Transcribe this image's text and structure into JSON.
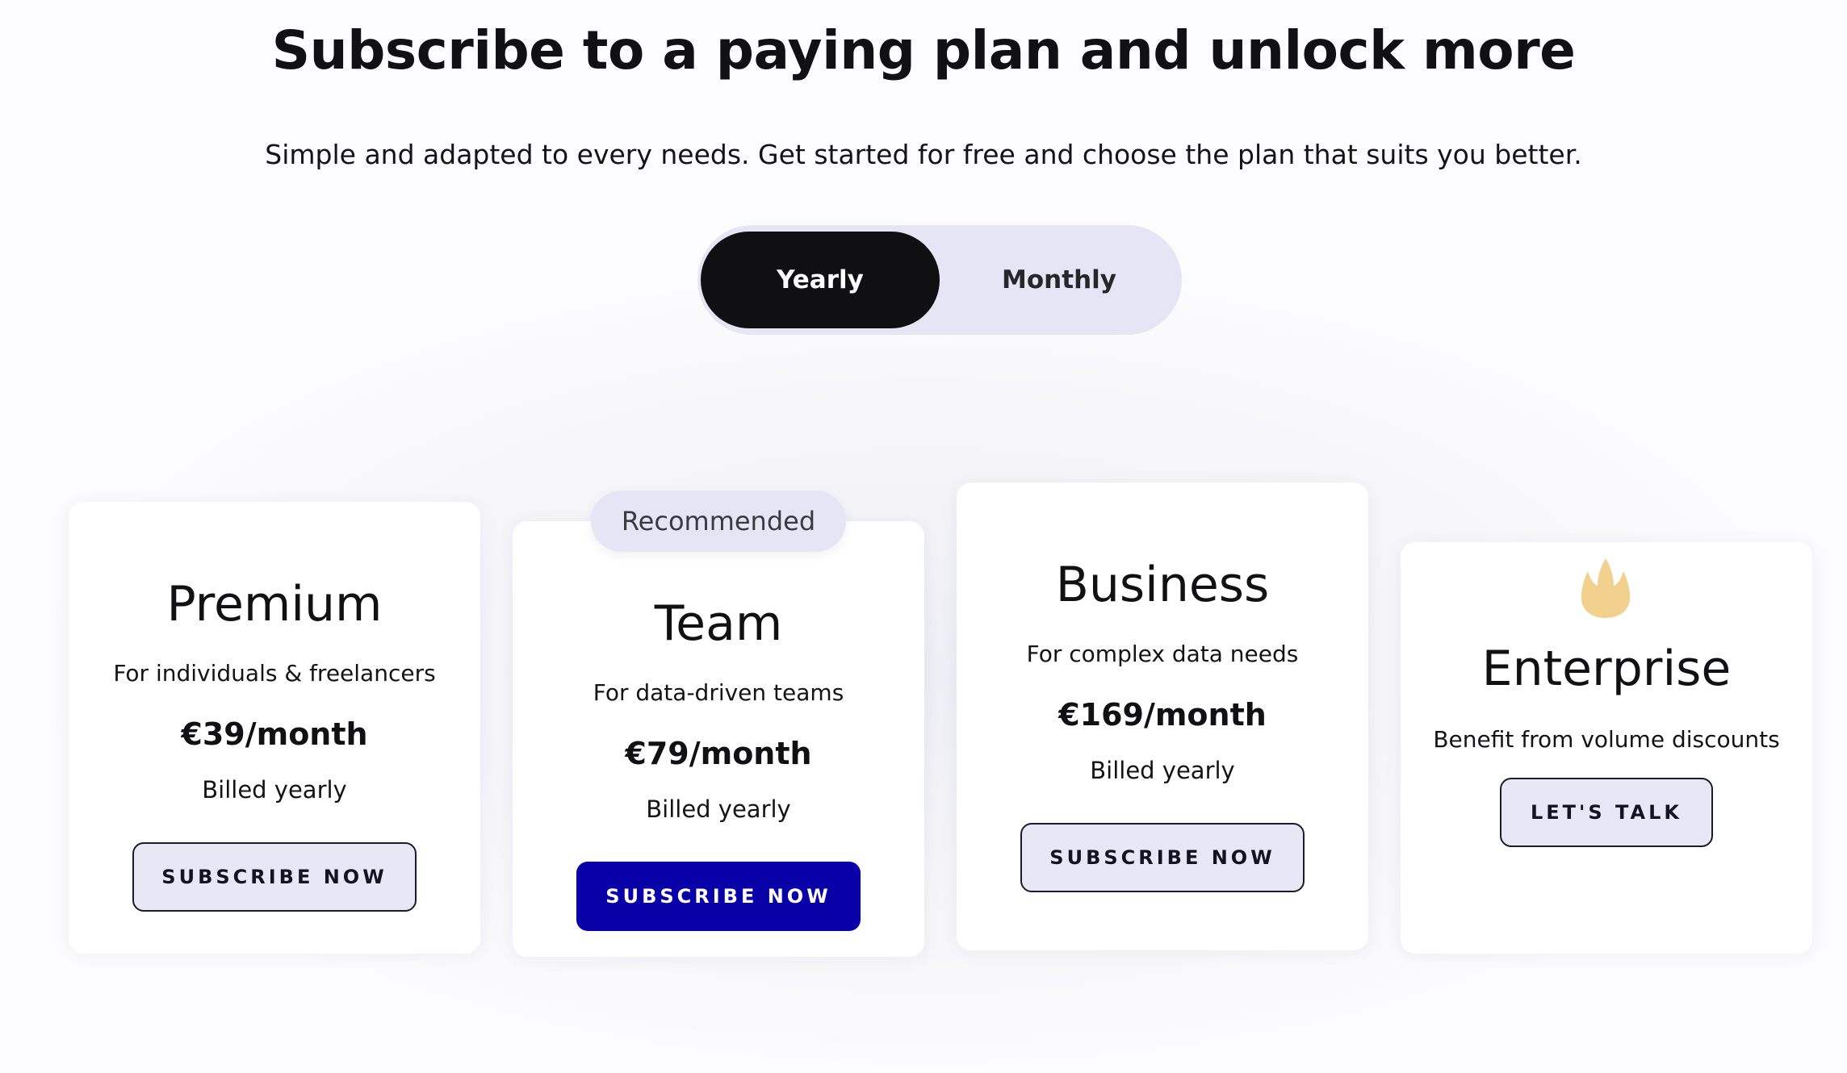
{
  "header": {
    "title": "Subscribe to a paying plan and unlock more",
    "subtitle": "Simple and adapted to every needs. Get started for free and choose the plan that suits you better."
  },
  "billing_toggle": {
    "options": [
      "Yearly",
      "Monthly"
    ],
    "selected": "Yearly"
  },
  "plans": [
    {
      "name": "Premium",
      "description": "For individuals & freelancers",
      "price": "€39/month",
      "billing": "Billed yearly",
      "button": "SUBSCRIBE NOW"
    },
    {
      "name": "Team",
      "badge": "Recommended",
      "description": "For data-driven teams",
      "price": "€79/month",
      "billing": "Billed yearly",
      "button": "SUBSCRIBE NOW"
    },
    {
      "name": "Business",
      "description": "For complex data needs",
      "price": "€169/month",
      "billing": "Billed yearly",
      "button": "SUBSCRIBE NOW"
    },
    {
      "name": "Enterprise",
      "icon": "flame-icon",
      "description": "Benefit from volume discounts",
      "button": "LET'S TALK"
    }
  ],
  "colors": {
    "primary_button": "#0a00a8",
    "toggle_active": "#101013",
    "pill_background": "#e6e5f5",
    "flame": "#f2d08e"
  }
}
